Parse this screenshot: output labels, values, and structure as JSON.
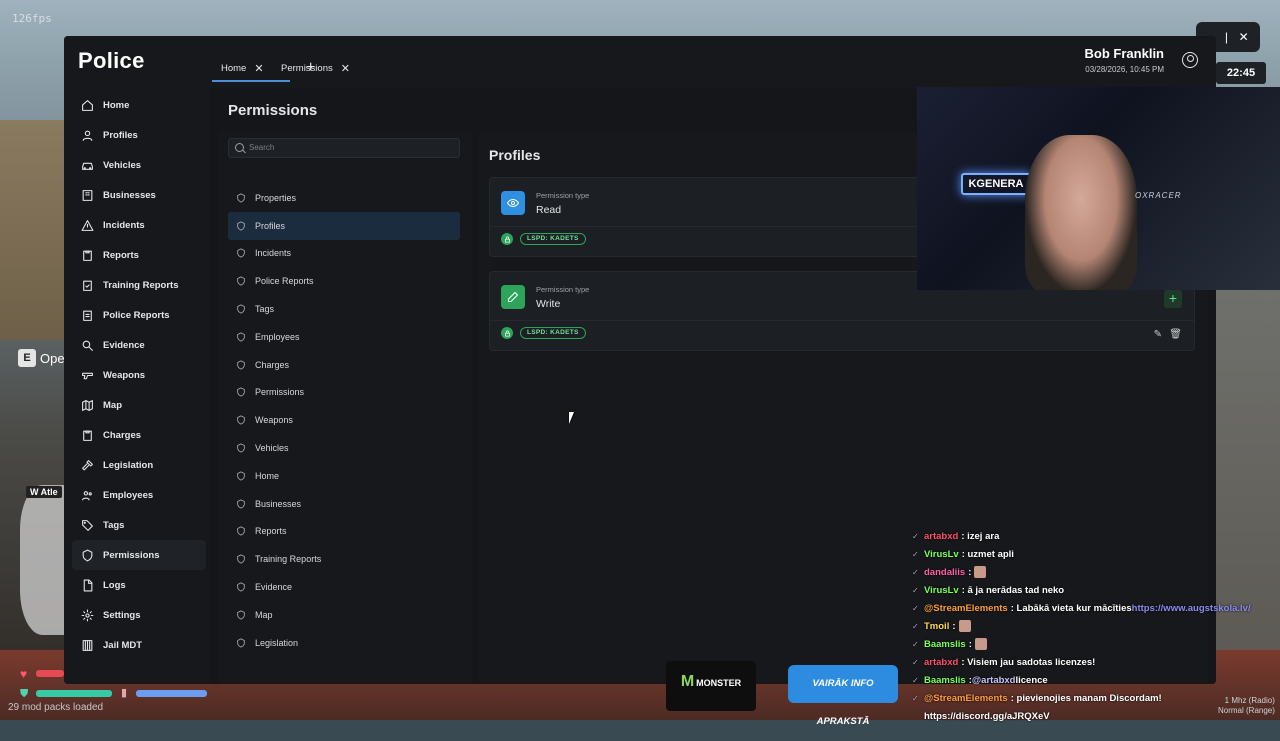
{
  "hud": {
    "fps": "126fps",
    "interact_key": "E",
    "interact_text": "Ope",
    "minimap_tag": "W Atle",
    "mods_loaded": "29 mod packs loaded",
    "clock": "22:45",
    "radio": [
      "1 Mhz (Radio)",
      "Normal (Range)"
    ]
  },
  "app": {
    "brand": "Police",
    "user_name": "Bob Franklin",
    "user_datetime": "03/28/2026, 10:45 PM",
    "tabs": [
      {
        "label": "Home",
        "close": "✕"
      },
      {
        "label": "Permissions",
        "close": "✕"
      }
    ],
    "new_tab": "+"
  },
  "sidebar": {
    "items": [
      {
        "label": "Home",
        "icon": "home-icon"
      },
      {
        "label": "Profiles",
        "icon": "user-icon"
      },
      {
        "label": "Vehicles",
        "icon": "car-icon"
      },
      {
        "label": "Businesses",
        "icon": "building-icon"
      },
      {
        "label": "Incidents",
        "icon": "warning-icon"
      },
      {
        "label": "Reports",
        "icon": "clipboard-icon"
      },
      {
        "label": "Training Reports",
        "icon": "clipboard-check-icon"
      },
      {
        "label": "Police Reports",
        "icon": "clipboard-list-icon"
      },
      {
        "label": "Evidence",
        "icon": "magnify-icon"
      },
      {
        "label": "Weapons",
        "icon": "gun-icon"
      },
      {
        "label": "Map",
        "icon": "map-icon"
      },
      {
        "label": "Charges",
        "icon": "clipboard-icon"
      },
      {
        "label": "Legislation",
        "icon": "gavel-icon"
      },
      {
        "label": "Employees",
        "icon": "users-icon"
      },
      {
        "label": "Tags",
        "icon": "tag-icon"
      },
      {
        "label": "Permissions",
        "icon": "shield-icon"
      },
      {
        "label": "Logs",
        "icon": "file-icon"
      },
      {
        "label": "Settings",
        "icon": "gear-icon"
      },
      {
        "label": "Jail MDT",
        "icon": "jail-icon"
      }
    ]
  },
  "permissions_page": {
    "title": "Permissions",
    "search_placeholder": "Search",
    "list": [
      "Properties",
      "Profiles",
      "Incidents",
      "Police Reports",
      "Tags",
      "Employees",
      "Charges",
      "Permissions",
      "Weapons",
      "Vehicles",
      "Home",
      "Businesses",
      "Reports",
      "Training Reports",
      "Evidence",
      "Map",
      "Legislation"
    ],
    "active_index": 1,
    "section_title": "Profiles",
    "cards": [
      {
        "type_label": "Permission type",
        "name": "Read",
        "tag": "LSPD: KADETS",
        "color": "#2f8fe0",
        "icon": "eye-icon"
      },
      {
        "type_label": "Permission type",
        "name": "Write",
        "tag": "LSPD: KADETS",
        "color": "#2ea35a",
        "icon": "pencil-icon"
      }
    ],
    "add": "+"
  },
  "stream": {
    "cam_neon": "KGENERA",
    "cam_chair": "OXRACER",
    "monster": "MONSTER",
    "info_banner": "VAIRĀK INFO APRAKSTĀ",
    "chat": [
      {
        "user": "artabxd",
        "color": "#ff4d6d",
        "text": ": izej ara"
      },
      {
        "user": "VirusLv",
        "color": "#7cff5a",
        "text": ": uzmet apli"
      },
      {
        "user": "dandaliis",
        "color": "#ff5fa8",
        "text": ":"
      },
      {
        "user": "VirusLv",
        "color": "#7cff5a",
        "text": ": ā ja nerādas tad neko"
      },
      {
        "user": "@StreamElements",
        "color": "#ff9b3d",
        "text": ": Labākā vieta kur mācīties ",
        "link": "https://www.augstskola.lv/"
      },
      {
        "user": "Tmoil",
        "color": "#ffd84a",
        "text": ":"
      },
      {
        "user": "Baamslis",
        "color": "#7cff5a",
        "text": ":"
      },
      {
        "user": "artabxd",
        "color": "#ff4d6d",
        "text": ": Visiem jau sadotas licenzes!"
      },
      {
        "user": "Baamslis",
        "color": "#7cff5a",
        "text": ": ",
        "mention": "@artabxd",
        "tail": " licence"
      },
      {
        "user": "@StreamElements",
        "color": "#ff9b3d",
        "text": ": pievienojies manam Discordam!"
      },
      {
        "user": "",
        "color": "#ffffff",
        "text": "https://discord.gg/aJRQXeV"
      }
    ]
  }
}
